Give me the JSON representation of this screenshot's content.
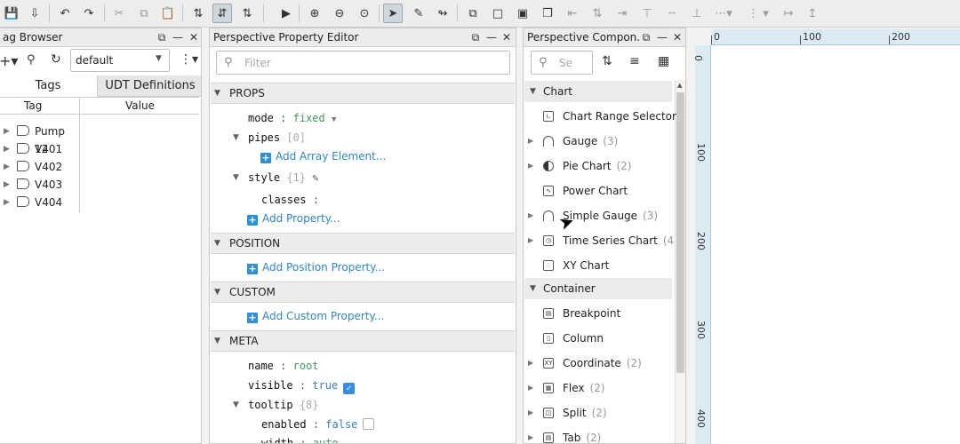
{
  "toolbar": {
    "icons": [
      "save-icon",
      "save-all-icon",
      "undo-icon",
      "redo-icon",
      "cut-icon",
      "copy-icon",
      "paste-icon",
      "snap-icon",
      "flip-vertical-icon",
      "flip-icon",
      "play-icon",
      "zoom-in-icon",
      "zoom-out-icon",
      "zoom-fit-icon",
      "select-icon",
      "edit-icon",
      "route-icon",
      "group-icon",
      "ungroup-icon",
      "bring-front-icon",
      "send-back-icon",
      "align-left-icon",
      "align-center-icon",
      "align-right-icon",
      "align-top-icon",
      "distribute-icon",
      "align-middle-icon",
      "spacing-icon",
      "align-bottom-icon"
    ]
  },
  "tag_browser": {
    "title": "ag Browser",
    "provider": "default",
    "tabs": [
      "Tags",
      "UDT Definitions"
    ],
    "columns": [
      "Tag",
      "Value"
    ],
    "rows": [
      "Pump 12",
      "V401",
      "V402",
      "V403",
      "V404"
    ]
  },
  "property_editor": {
    "title": "Perspective Property Editor",
    "filter_placeholder": "Filter",
    "sections": {
      "props": "PROPS",
      "position": "POSITION",
      "custom": "CUSTOM",
      "meta": "META"
    },
    "props": {
      "mode_key": "mode",
      "mode_val": "fixed",
      "pipes_key": "pipes",
      "pipes_count": "[0]",
      "add_array": "Add Array Element...",
      "style_key": "style",
      "style_count": "{1}",
      "classes_key": "classes",
      "add_property": "Add Property..."
    },
    "add_position": "Add Position Property...",
    "add_custom": "Add Custom Property...",
    "meta": {
      "name_key": "name",
      "name_val": "root",
      "visible_key": "visible",
      "visible_val": "true",
      "tooltip_key": "tooltip",
      "tooltip_count": "{8}",
      "enabled_key": "enabled",
      "enabled_val": "false",
      "width_key": "width",
      "width_val": "auto"
    },
    "colon": ":"
  },
  "components": {
    "title": "Perspective Compon...",
    "search_placeholder": "Se",
    "groups": [
      {
        "label": "Chart",
        "items": [
          {
            "name": "Chart Range Selector",
            "count": ""
          },
          {
            "name": "Gauge",
            "count": "(3)"
          },
          {
            "name": "Pie Chart",
            "count": "(2)"
          },
          {
            "name": "Power Chart",
            "count": ""
          },
          {
            "name": "Simple Gauge",
            "count": "(3)"
          },
          {
            "name": "Time Series Chart",
            "count": "(4"
          },
          {
            "name": "XY Chart",
            "count": ""
          }
        ]
      },
      {
        "label": "Container",
        "items": [
          {
            "name": "Breakpoint",
            "count": ""
          },
          {
            "name": "Column",
            "count": ""
          },
          {
            "name": "Coordinate",
            "count": "(2)"
          },
          {
            "name": "Flex",
            "count": "(2)"
          },
          {
            "name": "Split",
            "count": "(2)"
          },
          {
            "name": "Tab",
            "count": "(2)"
          }
        ]
      }
    ]
  },
  "designer": {
    "hruler": [
      "0",
      "100",
      "200"
    ],
    "vruler": [
      "0",
      "100",
      "200",
      "300",
      "400"
    ]
  }
}
